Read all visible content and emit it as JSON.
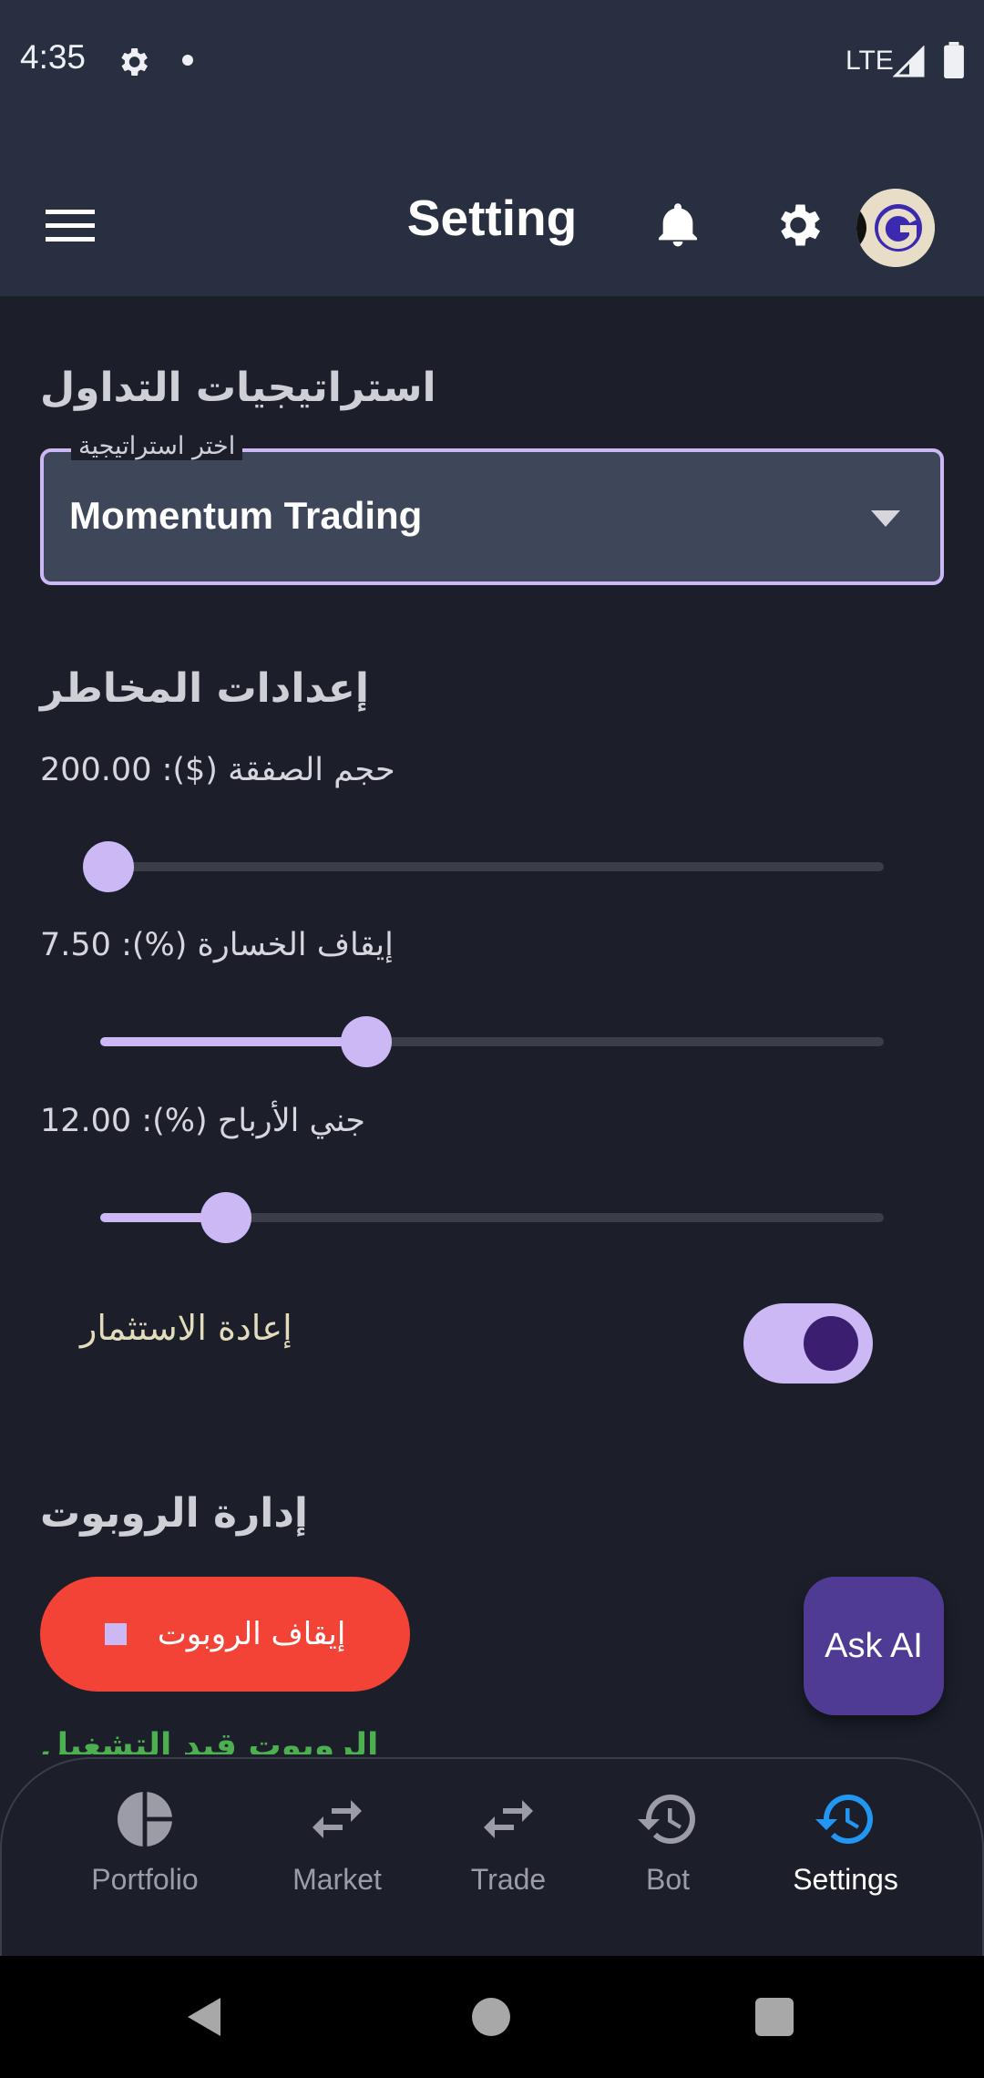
{
  "status_bar": {
    "time": "4:35",
    "network": "LTE"
  },
  "app_bar": {
    "title": "Setting"
  },
  "strategies": {
    "title": "استراتيجيات التداول",
    "dropdown_label": "اختر استراتيجية",
    "selected": "Momentum Trading"
  },
  "risk": {
    "title": "إعدادات المخاطر",
    "sliders": [
      {
        "label": "حجم الصفقة ($): 200.00",
        "fraction": 0.01
      },
      {
        "label": "إيقاف الخسارة (%): 7.50",
        "fraction": 0.34
      },
      {
        "label": "جني الأرباح (%): 12.00",
        "fraction": 0.16
      }
    ],
    "reinvest_label": "إعادة الاستثمار",
    "reinvest_on": true
  },
  "bot": {
    "title": "إدارة الروبوت",
    "stop_label": "إيقاف الروبوت",
    "status": "الروبوت قيد التشغيل"
  },
  "ask_ai": "Ask AI",
  "bottom_nav": {
    "items": [
      {
        "label": "Portfolio",
        "icon": "pie-chart-icon"
      },
      {
        "label": "Market",
        "icon": "swap-arrows-icon"
      },
      {
        "label": "Trade",
        "icon": "swap-arrows-icon"
      },
      {
        "label": "Bot",
        "icon": "history-icon"
      },
      {
        "label": "Settings",
        "icon": "history-icon"
      }
    ],
    "active_index": 4
  },
  "colors": {
    "accent": "#cbb8f5",
    "stop_red": "#f34336",
    "running_green": "#4caf50",
    "active_nav": "#2196f3"
  }
}
